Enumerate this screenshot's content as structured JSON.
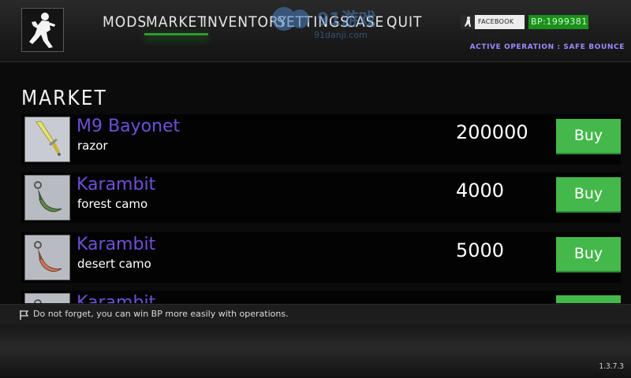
{
  "nav": {
    "items": [
      {
        "label": "MODS"
      },
      {
        "label": "MARKET",
        "active": true
      },
      {
        "label": "INVENTORY"
      },
      {
        "label": "SETTINGS"
      },
      {
        "label": "CASE"
      },
      {
        "label": "QUIT"
      }
    ]
  },
  "header": {
    "facebook_label": "FACEBOOK LOGIN",
    "bp_value": "BP:1999381",
    "operation": "ACTIVE OPERATION : SAFE BOUNCE",
    "watermark_main": "91游戏",
    "watermark_sub": "91danji.com"
  },
  "market": {
    "title": "MARKET",
    "items": [
      {
        "name": "M9 Bayonet",
        "skin": "razor",
        "price": "200000",
        "buy_label": "Buy",
        "thumb_icon": "m9-bayonet-razor-icon"
      },
      {
        "name": "Karambit",
        "skin": "forest camo",
        "price": "4000",
        "buy_label": "Buy",
        "thumb_icon": "karambit-forest-camo-icon"
      },
      {
        "name": "Karambit",
        "skin": "desert camo",
        "price": "5000",
        "buy_label": "Buy",
        "thumb_icon": "karambit-desert-camo-icon"
      },
      {
        "name": "Karambit",
        "skin": "",
        "price": "",
        "buy_label": "",
        "thumb_icon": "karambit-icon"
      }
    ]
  },
  "hint": "Do not forget, you can win BP more easily with operations.",
  "version": "1.3.7.3",
  "colors": {
    "accent_green": "#44b84a",
    "item_name_purple": "#6f4fd6",
    "operation_text": "#9a8cff",
    "bp_green": "#1c8f1c"
  }
}
